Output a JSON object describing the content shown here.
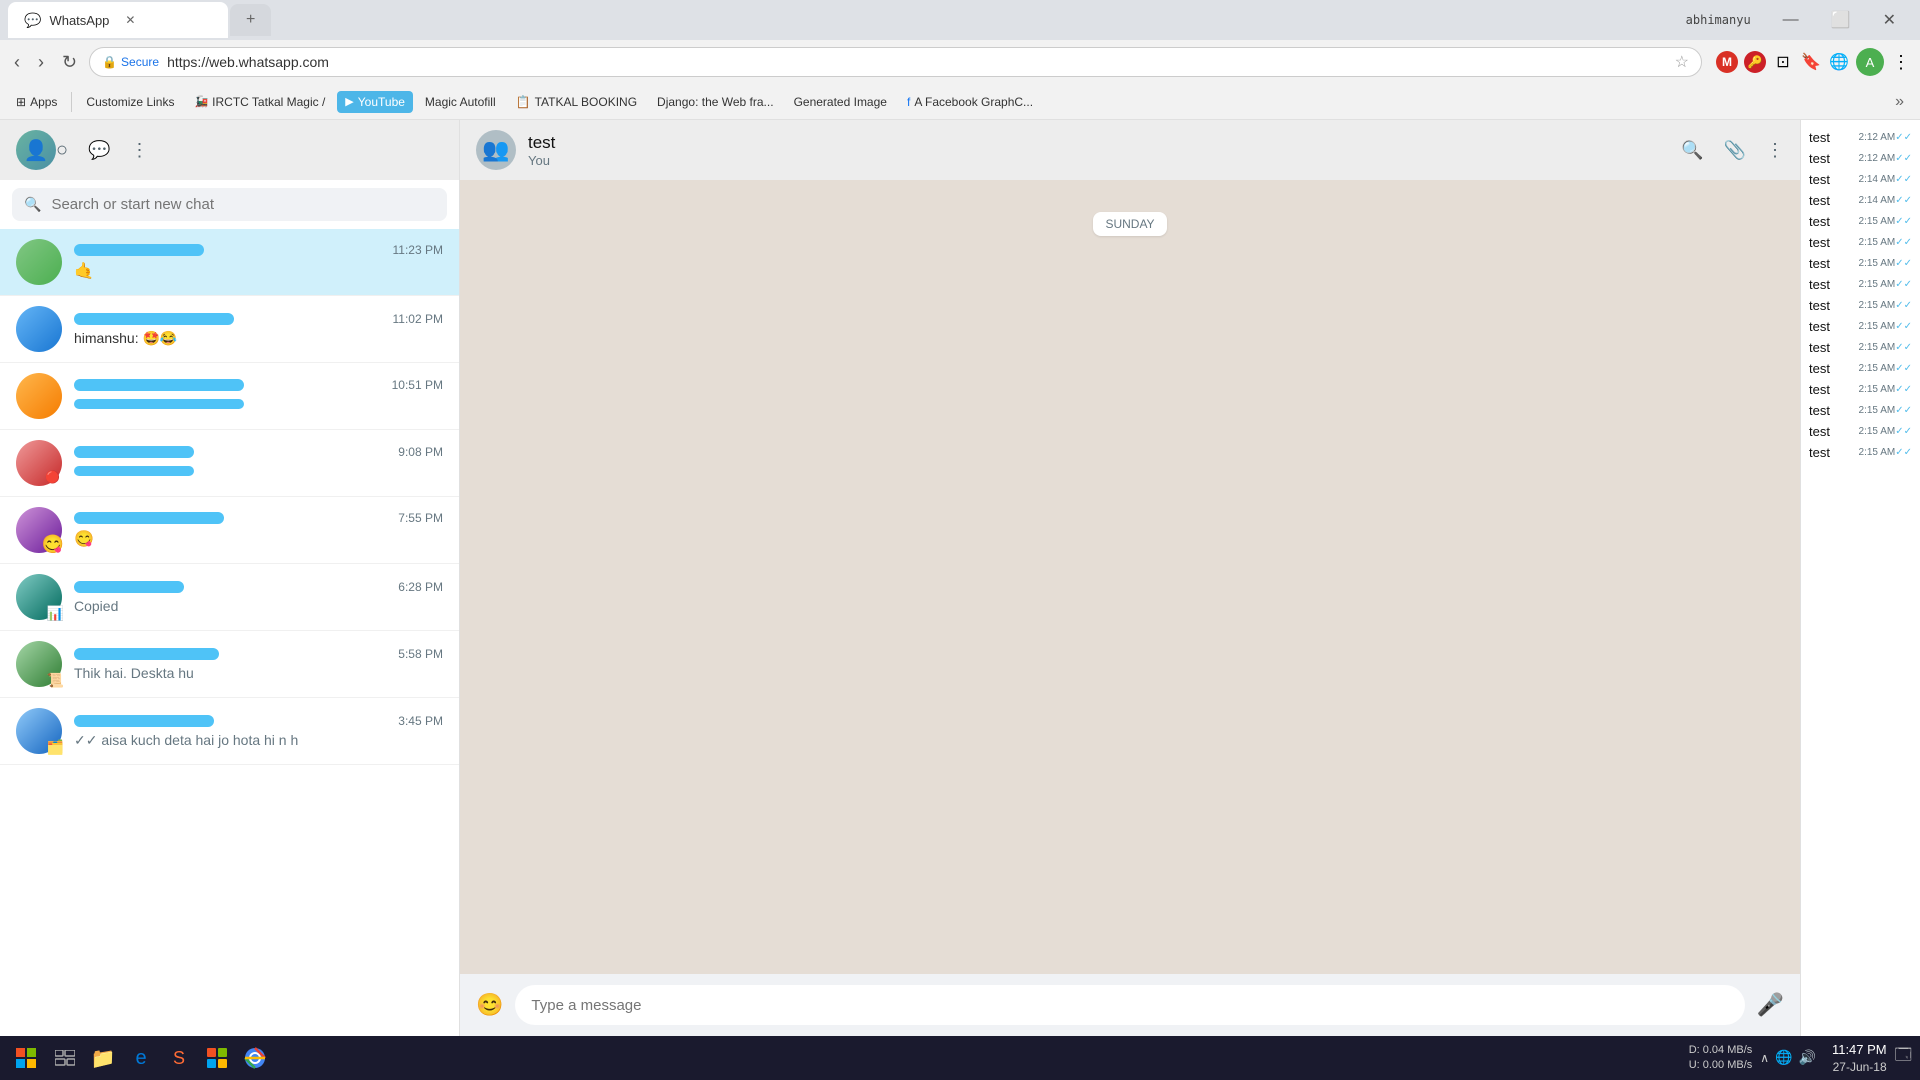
{
  "browser": {
    "tab_title": "WhatsApp",
    "tab_url": "https://web.whatsapp.com",
    "secure_label": "Secure",
    "url": "https://web.whatsapp.com",
    "user_name": "abhimanyu",
    "bookmarks": [
      {
        "label": "Apps",
        "icon": "⊞"
      },
      {
        "label": "Customize Links"
      },
      {
        "label": "IRCTC Tatkal Magic /"
      },
      {
        "label": "YouTube",
        "highlighted": true
      },
      {
        "label": "Magic Autofill"
      },
      {
        "label": "TATKAL BOOKING"
      },
      {
        "label": "Django: the Web fra..."
      },
      {
        "label": "Generated Image"
      },
      {
        "label": "A Facebook GraphC..."
      }
    ]
  },
  "whatsapp": {
    "search_placeholder": "Search or start new chat",
    "chat_header": {
      "name": "test",
      "status": "You"
    },
    "date_divider": "SUNDAY",
    "message_placeholder": "Type a message",
    "chats": [
      {
        "id": 1,
        "time": "11:23 PM",
        "preview_emoji": "🤙",
        "redacted": true,
        "redacted_width": 130
      },
      {
        "id": 2,
        "time": "11:02 PM",
        "sender": "himanshu:",
        "preview_emoji": "🤩😂",
        "redacted": true,
        "redacted_width": 160
      },
      {
        "id": 3,
        "time": "10:51 PM",
        "redacted": true,
        "redacted_width": 170
      },
      {
        "id": 4,
        "time": "9:08 PM",
        "redacted": true,
        "redacted_width": 120
      },
      {
        "id": 5,
        "time": "7:55 PM",
        "preview_emoji": "😋",
        "redacted": true,
        "redacted_width": 150
      },
      {
        "id": 6,
        "time": "6:28 PM",
        "preview_text": "Copied",
        "redacted": true,
        "redacted_width": 110
      },
      {
        "id": 7,
        "time": "5:58 PM",
        "preview_text": "Thik hai. Deskta hu",
        "redacted": true,
        "redacted_width": 145
      },
      {
        "id": 8,
        "time": "3:45 PM",
        "preview_text": "✓✓ aisa kuch deta hai jo hota hi n h",
        "redacted": true,
        "redacted_width": 140
      }
    ],
    "test_messages": [
      {
        "text": "test",
        "time": "2:12 AM",
        "ticks": "✓✓"
      },
      {
        "text": "test",
        "time": "2:12 AM",
        "ticks": "✓✓"
      },
      {
        "text": "test",
        "time": "2:14 AM",
        "ticks": "✓✓"
      },
      {
        "text": "test",
        "time": "2:14 AM",
        "ticks": "✓✓"
      },
      {
        "text": "test",
        "time": "2:15 AM",
        "ticks": "✓✓"
      },
      {
        "text": "test",
        "time": "2:15 AM",
        "ticks": "✓✓"
      },
      {
        "text": "test",
        "time": "2:15 AM",
        "ticks": "✓✓"
      },
      {
        "text": "test",
        "time": "2:15 AM",
        "ticks": "✓✓"
      },
      {
        "text": "test",
        "time": "2:15 AM",
        "ticks": "✓✓"
      },
      {
        "text": "test",
        "time": "2:15 AM",
        "ticks": "✓✓"
      },
      {
        "text": "test",
        "time": "2:15 AM",
        "ticks": "✓✓"
      },
      {
        "text": "test",
        "time": "2:15 AM",
        "ticks": "✓✓"
      },
      {
        "text": "test",
        "time": "2:15 AM",
        "ticks": "✓✓"
      },
      {
        "text": "test",
        "time": "2:15 AM",
        "ticks": "✓✓"
      },
      {
        "text": "test",
        "time": "2:15 AM",
        "ticks": "✓✓"
      },
      {
        "text": "test",
        "time": "2:15 AM",
        "ticks": "✓✓"
      }
    ]
  },
  "taskbar": {
    "time": "11:47 PM",
    "date": "27-Jun-18",
    "net_down": "0.04 MB/s",
    "net_up": "0.00 MB/s",
    "net_label": "D:",
    "net_label2": "U:"
  }
}
